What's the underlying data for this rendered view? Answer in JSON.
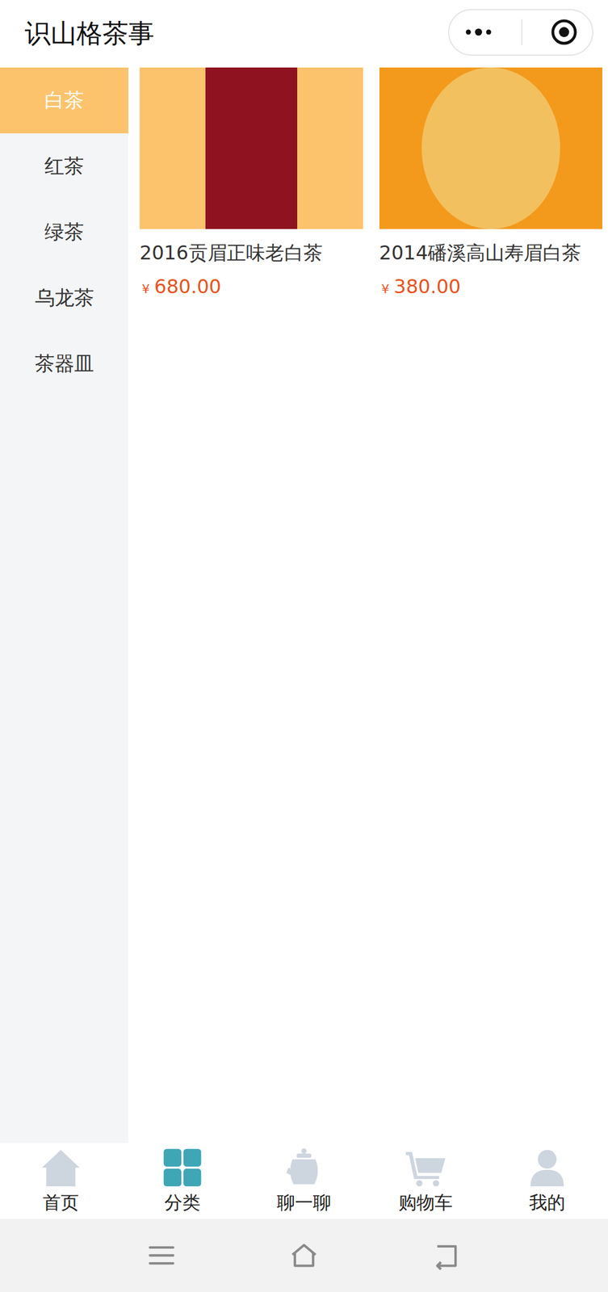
{
  "window": {
    "title": "识山格茶事"
  },
  "sidebar": {
    "items": [
      {
        "label": "白茶",
        "selected": true
      },
      {
        "label": "红茶",
        "selected": false
      },
      {
        "label": "绿茶",
        "selected": false
      },
      {
        "label": "乌龙茶",
        "selected": false
      },
      {
        "label": "茶器皿",
        "selected": false
      }
    ]
  },
  "products": [
    {
      "name": "2016贡眉正味老白茶",
      "currency": "¥",
      "price": "680.00"
    },
    {
      "name": "2014磻溪高山寿眉白茶",
      "currency": "¥",
      "price": "380.00"
    }
  ],
  "tab_bar": [
    {
      "label": "首页",
      "icon": "home",
      "selected": false
    },
    {
      "label": "分类",
      "icon": "grid",
      "selected": true
    },
    {
      "label": "聊一聊",
      "icon": "teapot",
      "selected": false
    },
    {
      "label": "购物车",
      "icon": "cart",
      "selected": false
    },
    {
      "label": "我的",
      "icon": "user",
      "selected": false
    }
  ]
}
